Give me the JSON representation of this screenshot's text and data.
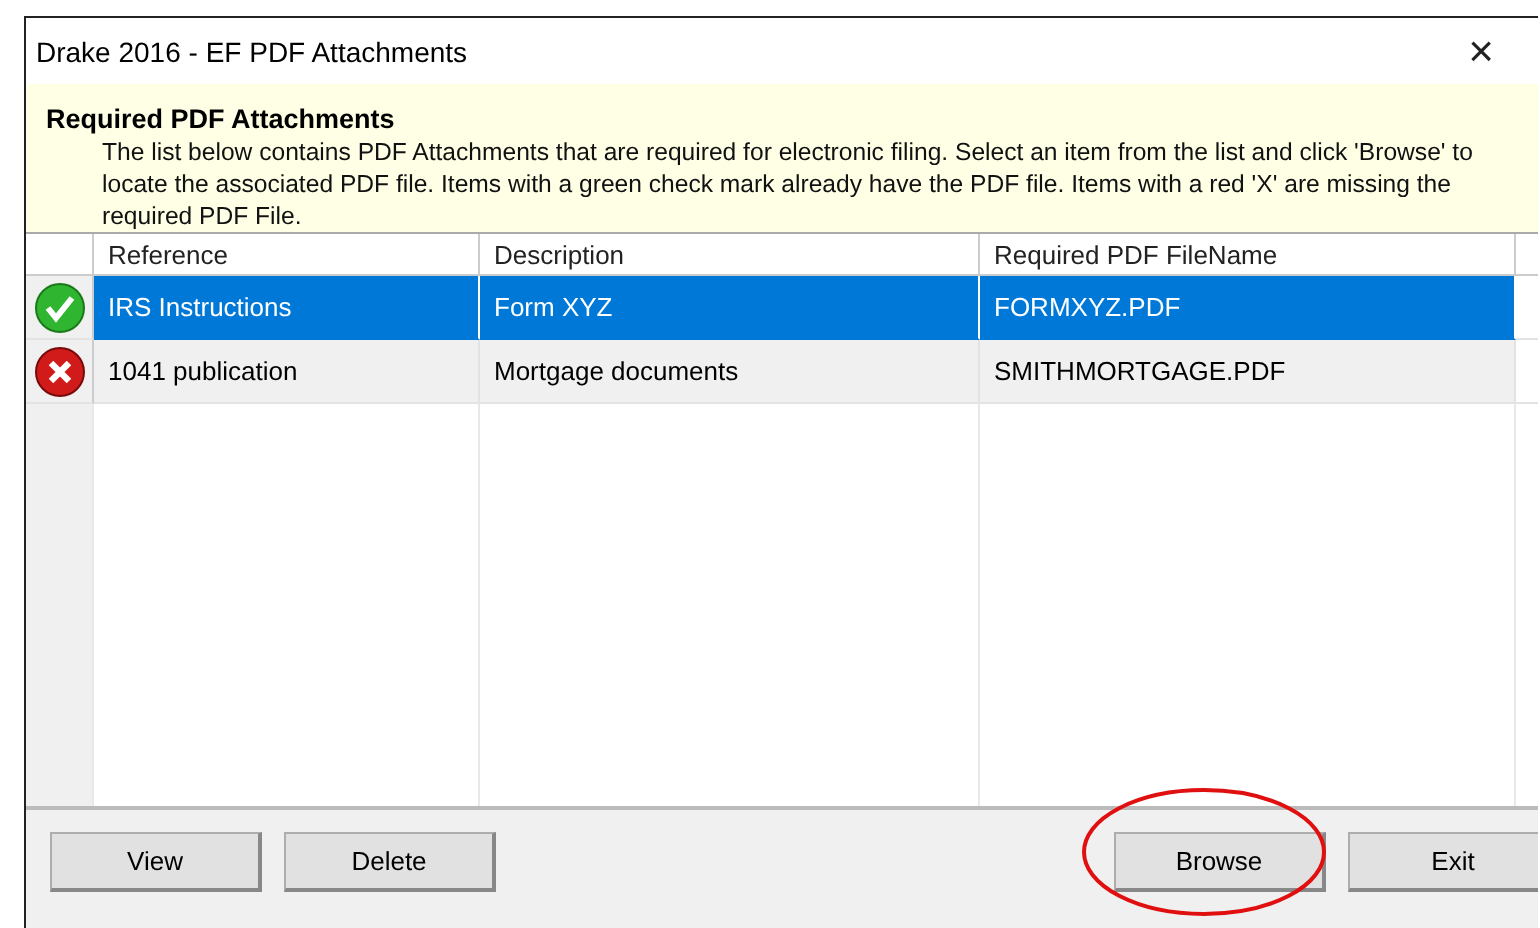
{
  "window": {
    "title": "Drake 2016 - EF PDF Attachments",
    "close": "×"
  },
  "info": {
    "heading": "Required PDF Attachments",
    "text": "The list below contains PDF Attachments that are required for electronic filing. Select an item from the list and click 'Browse' to locate the associated PDF file. Items with a green check mark already have the PDF file. Items with a red 'X' are missing the required PDF File."
  },
  "table": {
    "columns": [
      "Reference",
      "Description",
      "Required PDF FileName"
    ],
    "rows": [
      {
        "kind": "ok",
        "selected": true,
        "cells": [
          "IRS Instructions",
          "Form XYZ",
          "FORMXYZ.PDF"
        ]
      },
      {
        "kind": "missing",
        "selected": false,
        "cells": [
          "1041 publication",
          "Mortgage documents",
          "SMITHMORTGAGE.PDF"
        ]
      }
    ]
  },
  "buttons": [
    {
      "label": "View",
      "highlighted": false
    },
    {
      "label": "Delete",
      "highlighted": false
    },
    {
      "label": "Browse",
      "highlighted": true
    },
    {
      "label": "Exit",
      "highlighted": false
    }
  ]
}
